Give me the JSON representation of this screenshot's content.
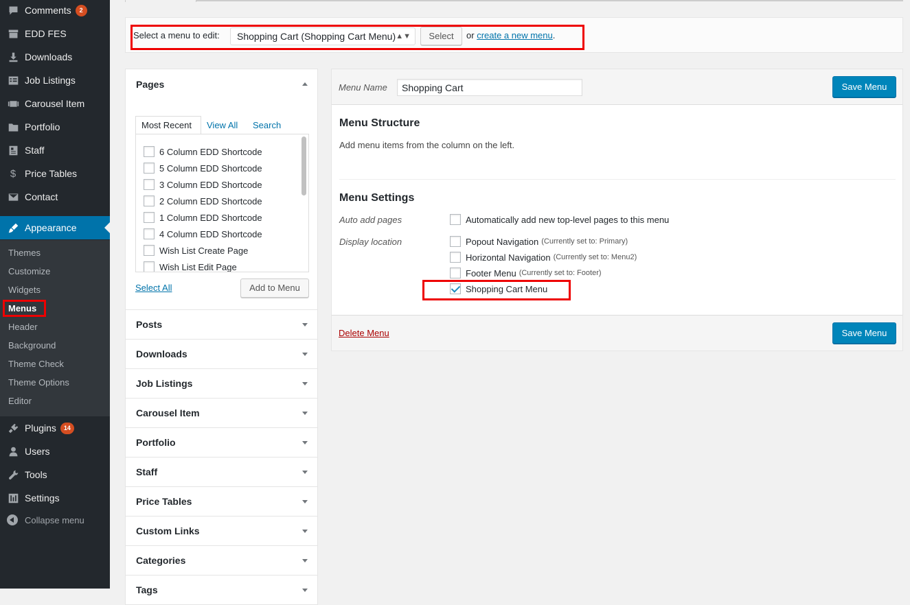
{
  "sidebar": {
    "items": [
      {
        "label": "Comments",
        "icon": "comment-icon",
        "badge": "2"
      },
      {
        "label": "EDD FES",
        "icon": "storefront-icon"
      },
      {
        "label": "Downloads",
        "icon": "download-icon"
      },
      {
        "label": "Job Listings",
        "icon": "list-icon"
      },
      {
        "label": "Carousel Item",
        "icon": "slides-icon"
      },
      {
        "label": "Portfolio",
        "icon": "folder-icon"
      },
      {
        "label": "Staff",
        "icon": "id-card-icon"
      },
      {
        "label": "Price Tables",
        "icon": "dollar-icon"
      },
      {
        "label": "Contact",
        "icon": "mail-icon"
      },
      {
        "label": "Appearance",
        "icon": "paint-brush-icon"
      }
    ],
    "submenu": [
      "Themes",
      "Customize",
      "Widgets",
      "Menus",
      "Header",
      "Background",
      "Theme Check",
      "Theme Options",
      "Editor"
    ],
    "lower_items": [
      {
        "label": "Plugins",
        "icon": "plugin-icon",
        "badge": "14"
      },
      {
        "label": "Users",
        "icon": "user-icon"
      },
      {
        "label": "Tools",
        "icon": "wrench-icon"
      },
      {
        "label": "Settings",
        "icon": "settings-icon"
      }
    ],
    "collapse_label": "Collapse menu"
  },
  "manage": {
    "label": "Select a menu to edit:",
    "selected_menu": "Shopping Cart (Shopping Cart Menu)",
    "select_button": "Select",
    "or_text": "or",
    "create_link": "create a new menu",
    "period": "."
  },
  "pages_box": {
    "title": "Pages",
    "tabs": [
      "Most Recent",
      "View All",
      "Search"
    ],
    "pages": [
      "6 Column EDD Shortcode",
      "5 Column EDD Shortcode",
      "3 Column EDD Shortcode",
      "2 Column EDD Shortcode",
      "1 Column EDD Shortcode",
      "4 Column EDD Shortcode",
      "Wish List Create Page",
      "Wish List Edit Page"
    ],
    "select_all": "Select All",
    "add_button": "Add to Menu"
  },
  "accordions": [
    "Posts",
    "Downloads",
    "Job Listings",
    "Carousel Item",
    "Portfolio",
    "Staff",
    "Price Tables",
    "Custom Links",
    "Categories",
    "Tags"
  ],
  "edit": {
    "menu_name_label": "Menu Name",
    "menu_name_value": "Shopping Cart",
    "save_label": "Save Menu",
    "structure_title": "Menu Structure",
    "structure_hint": "Add menu items from the column on the left.",
    "settings_title": "Menu Settings",
    "auto_add_label": "Auto add pages",
    "auto_add_text": "Automatically add new top-level pages to this menu",
    "display_location_label": "Display location",
    "locations": [
      {
        "name": "Popout Navigation",
        "note": "(Currently set to: Primary)",
        "checked": false
      },
      {
        "name": "Horizontal Navigation",
        "note": "(Currently set to: Menu2)",
        "checked": false
      },
      {
        "name": "Footer Menu",
        "note": "(Currently set to: Footer)",
        "checked": false
      },
      {
        "name": "Shopping Cart Menu",
        "note": "",
        "checked": true
      }
    ],
    "delete_label": "Delete Menu"
  },
  "colors": {
    "sidebar_bg": "#23282d",
    "submenu_bg": "#32373c",
    "accent": "#0073aa",
    "primary_button": "#0085ba",
    "badge": "#d54e21",
    "highlight_box": "#ee0000",
    "delete_link": "#aa0000"
  }
}
